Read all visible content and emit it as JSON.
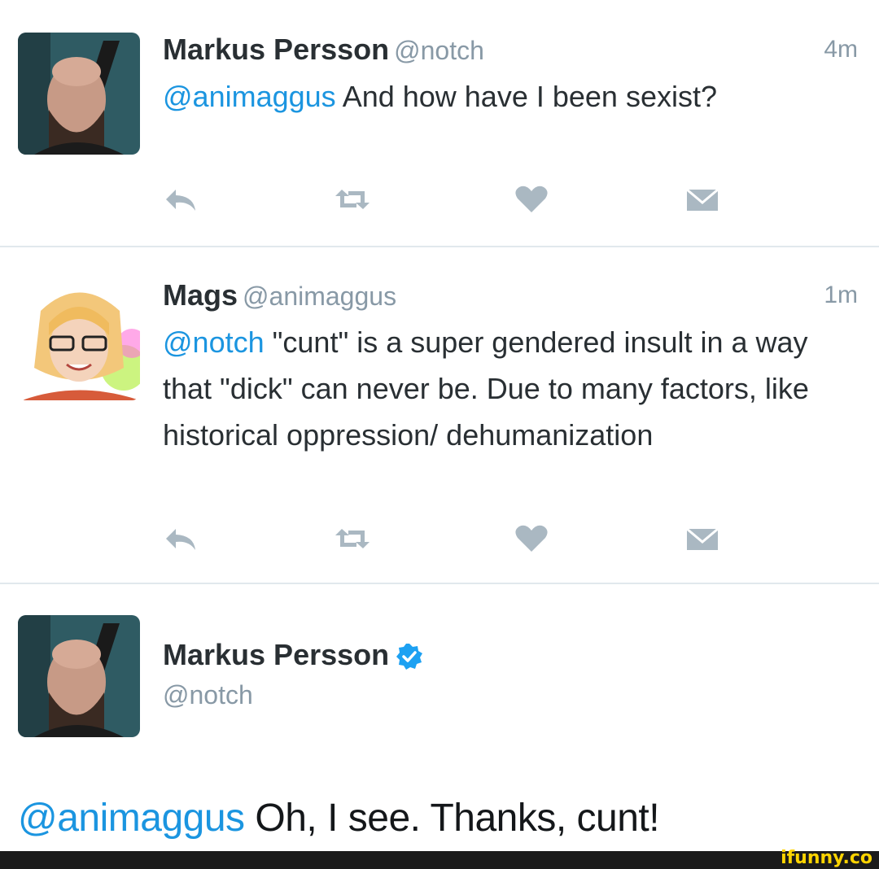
{
  "tweets": [
    {
      "name": "Markus Persson",
      "handle": "@notch",
      "time": "4m",
      "mention": "@animaggus",
      "text": " And how have I been sexist?"
    },
    {
      "name": "Mags",
      "handle": "@animaggus",
      "time": "1m",
      "mention": "@notch",
      "text": " \"cunt\" is a super gendered insult in a way that \"dick\" can never be. Due to many factors, like historical oppression/ dehumanization"
    }
  ],
  "reply": {
    "name": "Markus Persson",
    "handle": "@notch",
    "mention": "@animaggus",
    "text": " Oh, I see. Thanks, cunt!"
  },
  "watermark": "ifunny.co",
  "colors": {
    "mention": "#1b95e0",
    "icon": "#aab8c2",
    "verified": "#1da1f2"
  },
  "icons": [
    "reply-icon",
    "retweet-icon",
    "like-icon",
    "dm-icon",
    "verified-badge-icon"
  ]
}
